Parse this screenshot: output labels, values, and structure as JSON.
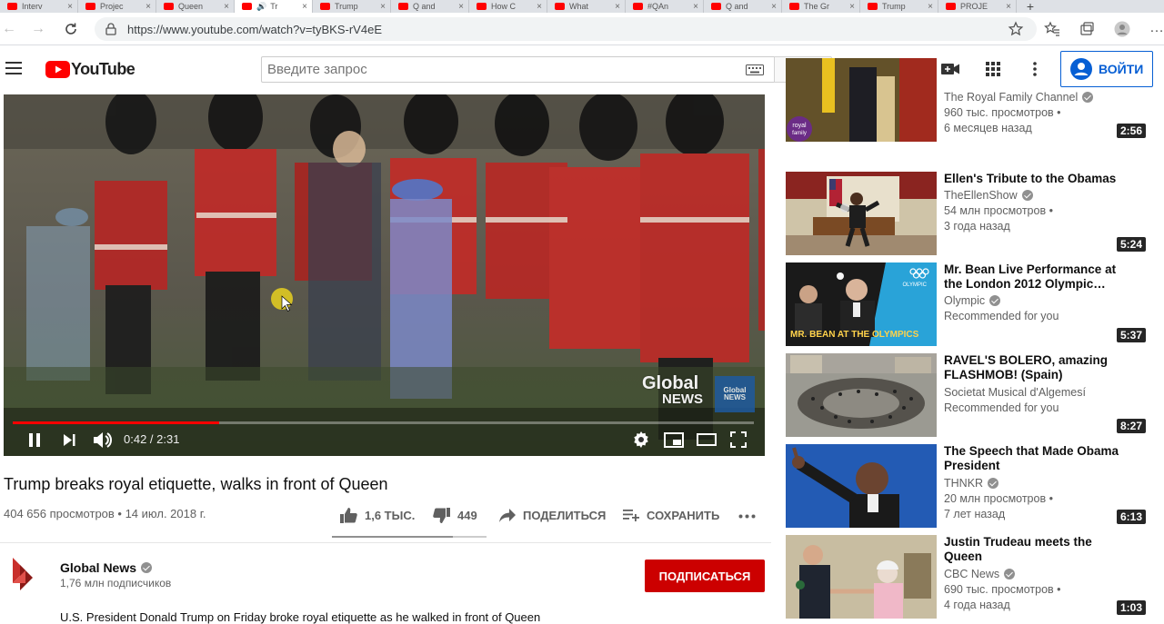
{
  "browser": {
    "tabs": [
      {
        "label": "Interv",
        "active": false
      },
      {
        "label": "Projec",
        "active": false
      },
      {
        "label": "Queen",
        "active": false
      },
      {
        "label": "Tr",
        "active": true
      },
      {
        "label": "Trump",
        "active": false
      },
      {
        "label": "Q and",
        "active": false
      },
      {
        "label": "How C",
        "active": false
      },
      {
        "label": "What",
        "active": false
      },
      {
        "label": "#QAn",
        "active": false
      },
      {
        "label": "Q and",
        "active": false
      },
      {
        "label": "The Gr",
        "active": false
      },
      {
        "label": "Trump",
        "active": false
      },
      {
        "label": "PROJE",
        "active": false
      }
    ],
    "url": "https://www.youtube.com/watch?v=tyBKS-rV4eE"
  },
  "header": {
    "logo_text": "YouTube",
    "search_placeholder": "Введите запрос",
    "signin_label": "ВОЙТИ"
  },
  "player": {
    "time": "0:42 / 2:31",
    "progress_fraction": 0.278,
    "watermark_line1": "Global",
    "watermark_line2": "NEWS",
    "watermark_badge_line1": "Global",
    "watermark_badge_line2": "NEWS"
  },
  "video": {
    "title": "Trump breaks royal etiquette, walks in front of Queen",
    "views_date": "404 656 просмотров • 14 июл. 2018 г.",
    "likes": "1,6 ТЫС.",
    "dislikes": "449",
    "share_label": "ПОДЕЛИТЬСЯ",
    "save_label": "СОХРАНИТЬ",
    "like_fraction": 0.78
  },
  "channel": {
    "name": "Global News",
    "subscribers": "1,76 млн подписчиков",
    "subscribe_label": "ПОДПИСАТЬСЯ",
    "description": "U.S. President Donald Trump on Friday broke royal etiquette as he walked in front of Queen"
  },
  "recommendations": [
    {
      "title": "",
      "channel": "The Royal Family Channel",
      "meta1": "960 тыс. просмотров •",
      "meta2": "6 месяцев назад",
      "duration": "2:56",
      "thumb_text": "royal family"
    },
    {
      "title": "Ellen's Tribute to the Obamas",
      "channel": "TheEllenShow",
      "meta1": "54 млн просмотров •",
      "meta2": "3 года назад",
      "duration": "5:24",
      "thumb_text": ""
    },
    {
      "title": "Mr. Bean Live Performance at the London 2012 Olympic…",
      "channel": "Olympic",
      "meta1": "Recommended for you",
      "meta2": "",
      "duration": "5:37",
      "thumb_text": "MR. BEAN AT THE OLYMPICS"
    },
    {
      "title": "RAVEL'S BOLERO, amazing FLASHMOB! (Spain)",
      "channel": "Societat Musical d'Algemesí",
      "meta1": "Recommended for you",
      "meta2": "",
      "duration": "8:27",
      "thumb_text": ""
    },
    {
      "title": "The Speech that Made Obama President",
      "channel": "THNKR",
      "meta1": "20 млн просмотров •",
      "meta2": "7 лет назад",
      "duration": "6:13",
      "thumb_text": ""
    },
    {
      "title": "Justin Trudeau meets the Queen",
      "channel": "CBC News",
      "meta1": "690 тыс. просмотров •",
      "meta2": "4 года назад",
      "duration": "1:03",
      "thumb_text": ""
    }
  ],
  "colors": {
    "accent_red": "#ff0000",
    "subscribe_red": "#cc0000",
    "link_blue": "#065fd4"
  }
}
